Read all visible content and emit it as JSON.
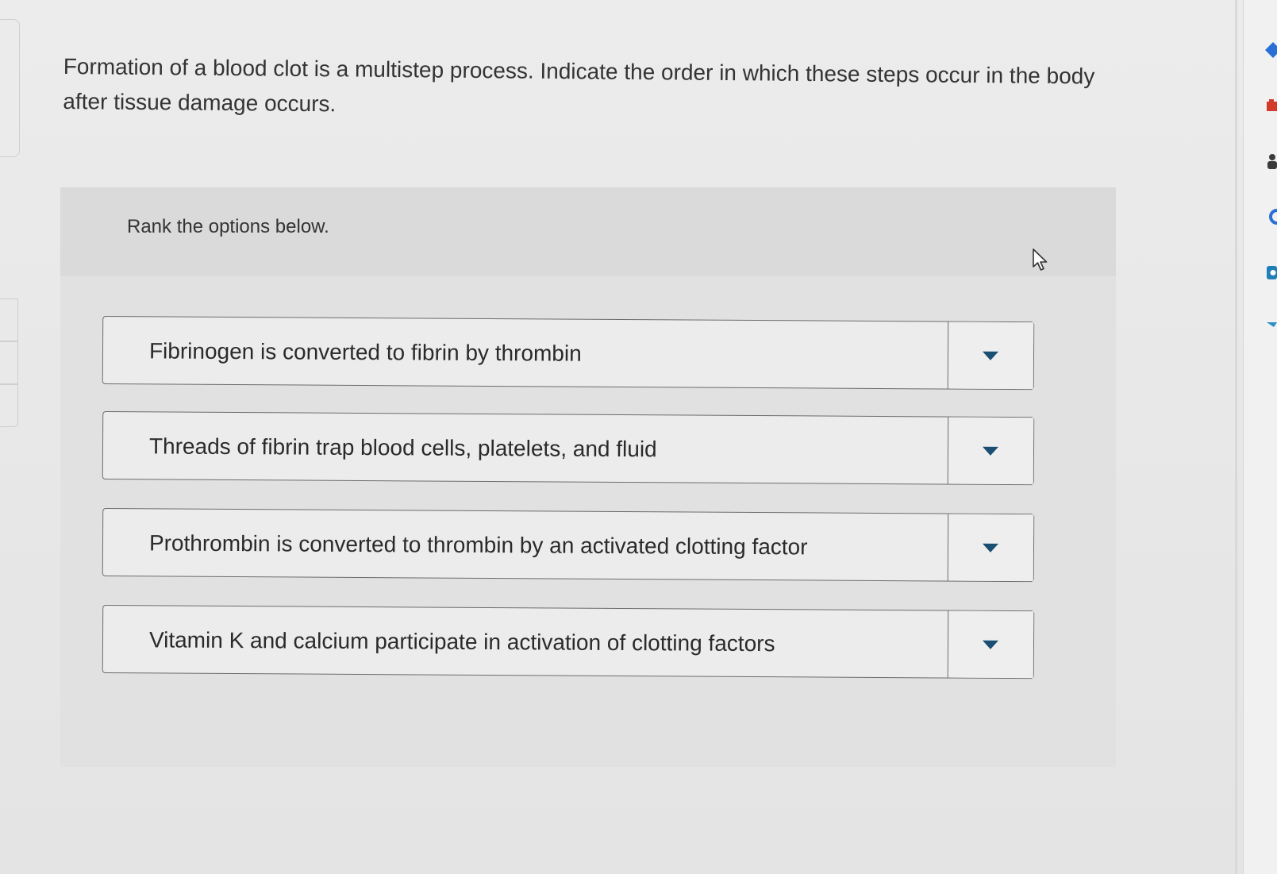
{
  "question": {
    "text": "Formation of a blood clot is a multistep process. Indicate the order in which these steps occur in the body after tissue damage occurs."
  },
  "ranking": {
    "instruction": "Rank the options below.",
    "items": [
      {
        "label": "Fibrinogen is converted to fibrin by thrombin",
        "rank": ""
      },
      {
        "label": "Threads of fibrin trap blood cells, platelets, and fluid",
        "rank": ""
      },
      {
        "label": "Prothrombin is converted to thrombin by an activated clotting factor",
        "rank": ""
      },
      {
        "label": "Vitamin K and calcium participate in activation of clotting factors",
        "rank": ""
      }
    ]
  },
  "right_rail": {
    "icons": [
      "blue-diamond-icon",
      "red-box-icon",
      "person-icon",
      "chat-bubble-icon",
      "camera-icon",
      "pin-icon"
    ]
  },
  "colors": {
    "caret": "#1a4e72",
    "border": "#6c6c6c",
    "panel": "#e1e1e1"
  }
}
